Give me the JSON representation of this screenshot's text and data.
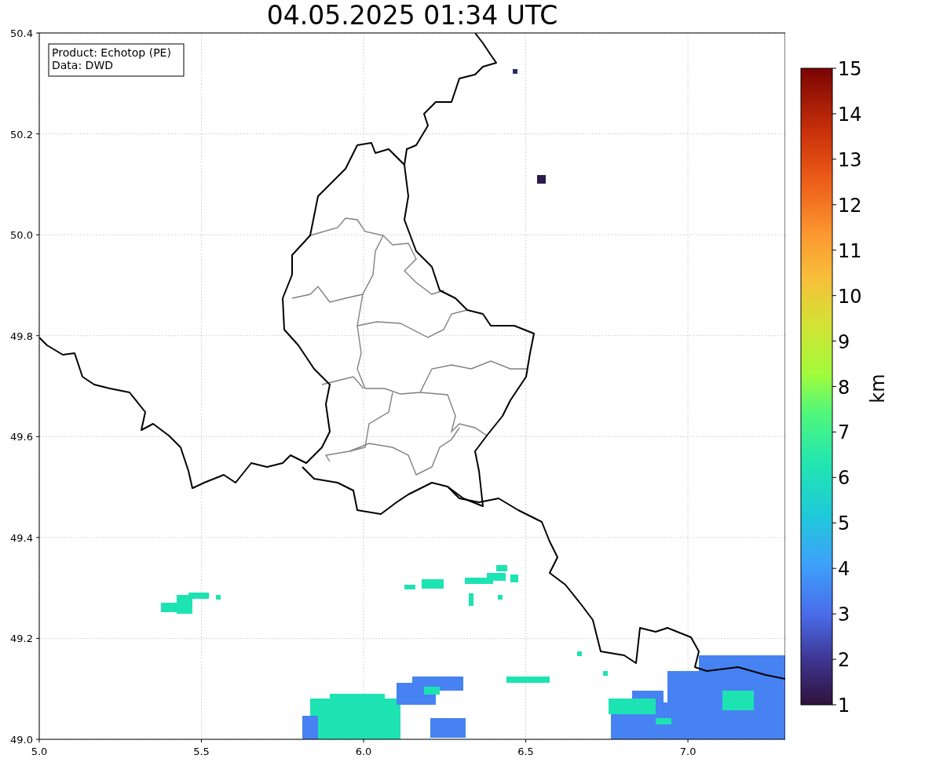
{
  "title": "04.05.2025 01:34 UTC",
  "info_box": [
    "Product: Echotop (PE)",
    "Data: DWD"
  ],
  "x_axis": {
    "ticks": [
      "5.0",
      "5.5",
      "6.0",
      "6.5",
      "7.0"
    ]
  },
  "y_axis": {
    "ticks": [
      "50.4",
      "50.2",
      "50.0",
      "49.8",
      "49.6",
      "49.4",
      "49.2",
      "49.0"
    ]
  },
  "colorbar": {
    "label": "km",
    "ticks": [
      "15",
      "14",
      "13",
      "12",
      "11",
      "10",
      "9",
      "8",
      "7",
      "6",
      "5",
      "4",
      "3",
      "2",
      "1"
    ]
  }
}
